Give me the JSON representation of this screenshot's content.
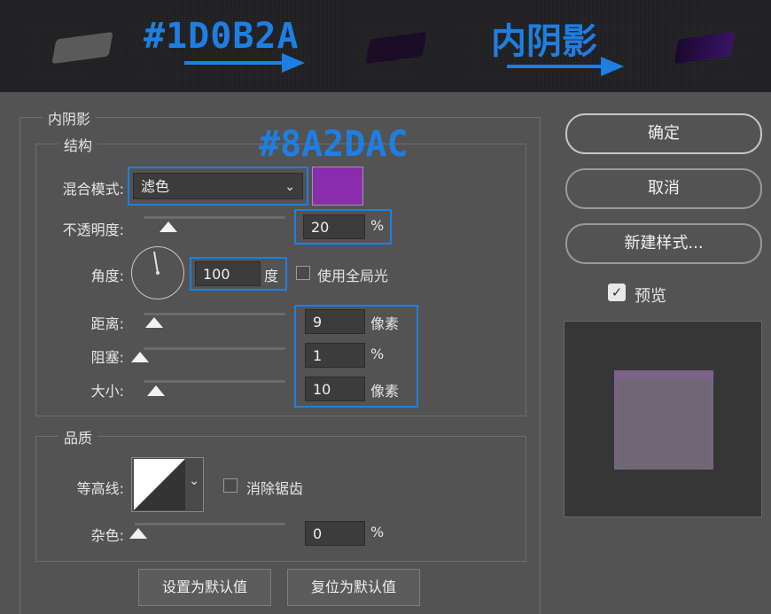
{
  "annotations": {
    "top_color": "#1D0B2A",
    "top_effect": "内阴影",
    "panel_color": "#8A2DAC",
    "annotation_color": "#1e7fe3"
  },
  "banner": {
    "swatches": [
      {
        "name": "gray-swatch",
        "color": "#5a5a5a"
      },
      {
        "name": "dark-purple-swatch",
        "color": "#1D0B2A"
      },
      {
        "name": "purple-swatch",
        "color": "#2c0f4a"
      }
    ]
  },
  "dialog": {
    "section_title": "内阴影",
    "structure": {
      "title": "结构",
      "blend_mode_label": "混合模式:",
      "blend_mode_value": "滤色",
      "blend_color": "#8A2DAC",
      "opacity_label": "不透明度:",
      "opacity_value": "20",
      "opacity_unit": "%",
      "opacity_level": 0.2,
      "angle_label": "角度:",
      "angle_value": "100",
      "angle_unit": "度",
      "global_light_label": "使用全局光",
      "global_light_checked": false,
      "distance_label": "距离:",
      "distance_value": "9",
      "distance_unit": "像素",
      "choke_label": "阻塞:",
      "choke_value": "1",
      "choke_unit": "%",
      "size_label": "大小:",
      "size_value": "10",
      "size_unit": "像素"
    },
    "quality": {
      "title": "品质",
      "contour_label": "等高线:",
      "anti_alias_label": "消除锯齿",
      "anti_alias_checked": false,
      "noise_label": "杂色:",
      "noise_value": "0",
      "noise_unit": "%"
    },
    "buttons": {
      "set_default": "设置为默认值",
      "reset_default": "复位为默认值",
      "ok": "确定",
      "cancel": "取消",
      "new_style": "新建样式...",
      "preview_label": "预览",
      "preview_checked": true
    },
    "preview": {
      "bg_color": "#363636",
      "swatch_color": "#6f6874"
    }
  }
}
